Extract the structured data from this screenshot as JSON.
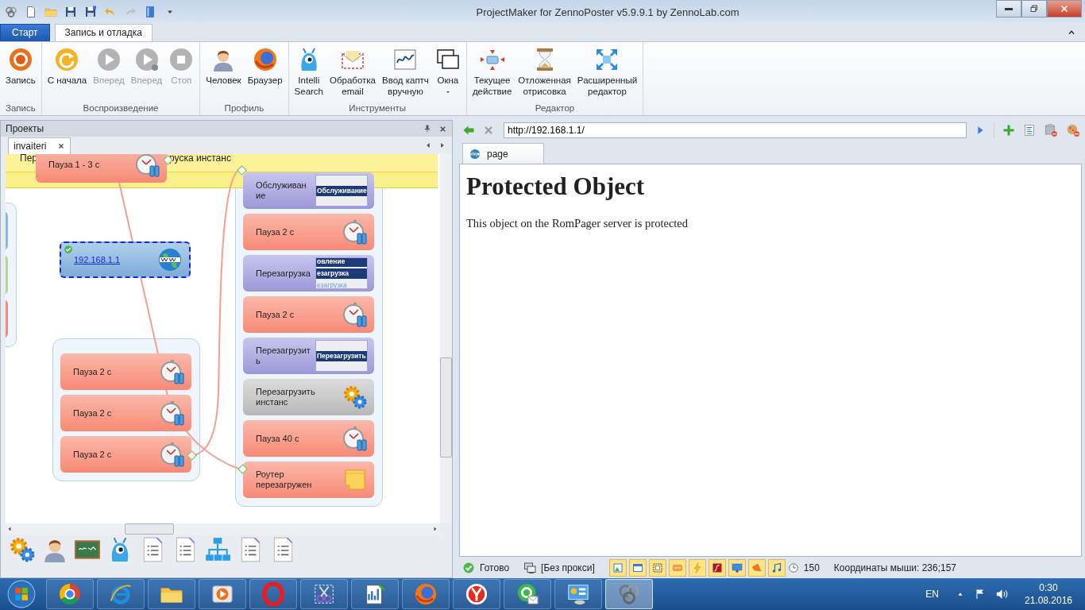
{
  "window": {
    "title": "ProjectMaker for ZennoPoster v5.9.9.1 by ZennoLab.com"
  },
  "ribbon": {
    "tabs": [
      {
        "label": "Старт",
        "kind": "menu",
        "selected": false
      },
      {
        "label": "Запись и отладка",
        "kind": "tab",
        "selected": true
      }
    ],
    "groups": [
      {
        "title": "Запись",
        "buttons": [
          {
            "label": "Запись",
            "disabled": false
          }
        ]
      },
      {
        "title": "Воспроизведение",
        "buttons": [
          {
            "label": "С начала",
            "disabled": false
          },
          {
            "label": "Вперед",
            "disabled": true
          },
          {
            "label": "Вперед",
            "disabled": true
          },
          {
            "label": "Стоп",
            "disabled": true
          }
        ]
      },
      {
        "title": "Профиль",
        "buttons": [
          {
            "label": "Человек",
            "disabled": false
          },
          {
            "label": "Браузер",
            "disabled": false
          }
        ]
      },
      {
        "title": "Инструменты",
        "buttons": [
          {
            "label": "Intelli\nSearch",
            "disabled": false
          },
          {
            "label": "Обработка\nemail",
            "disabled": false
          },
          {
            "label": "Ввод каптч\nвручную",
            "disabled": false
          },
          {
            "label": "Окна",
            "disabled": false,
            "dropdown": true
          }
        ]
      },
      {
        "title": "Редактор",
        "buttons": [
          {
            "label": "Текущее\nдействие",
            "disabled": false
          },
          {
            "label": "Отложенная\nотрисовка",
            "disabled": false
          },
          {
            "label": "Расширенный\nредактор",
            "disabled": false
          }
        ]
      }
    ]
  },
  "projects": {
    "title": "Проекты",
    "tabs": [
      {
        "label": "invaiteri",
        "selected": true
      }
    ],
    "canvas": {
      "band_texts": [
        "Пер",
        "руска инстанс"
      ],
      "offscreen_nodes": [
        {
          "color": "#8db8e3"
        },
        {
          "color": "#aedb94"
        },
        {
          "color": "#f48b7b"
        }
      ],
      "free_nodes": [
        {
          "kind": "pause",
          "label": "Пауза 1 - 3 с",
          "selected": false,
          "done": false
        },
        {
          "kind": "navigate",
          "label": "192.168.1.1",
          "selected": true,
          "done": true
        }
      ],
      "groups": [
        {
          "nodes": [
            {
              "kind": "pause",
              "label": "Пауза 2 с",
              "selected": false,
              "done": false
            },
            {
              "kind": "pause",
              "label": "Пауза 2 с",
              "selected": false,
              "done": false
            },
            {
              "kind": "pause",
              "label": "Пауза 2 с",
              "selected": false,
              "done": false
            }
          ]
        },
        {
          "nodes": [
            {
              "kind": "image",
              "label": "Обслуживан\nие",
              "snapshot": [
                "Обслуживание"
              ],
              "selected": false,
              "done": false
            },
            {
              "kind": "pause",
              "label": "Пауза 2 с",
              "selected": false,
              "done": false
            },
            {
              "kind": "image",
              "label": "Перезагрузка",
              "snapshot": [
                "овление",
                "езагрузка",
                "езагрузка"
              ],
              "selected": false,
              "done": false
            },
            {
              "kind": "pause",
              "label": "Пауза 2 с",
              "selected": false,
              "done": false
            },
            {
              "kind": "image",
              "label": "Перезагрузит\nь",
              "snapshot": [
                "Перезагрузить"
              ],
              "selected": false,
              "done": false
            },
            {
              "kind": "action",
              "label": "Перезагрузить\nинстанс",
              "selected": false,
              "done": false
            },
            {
              "kind": "pause",
              "label": "Пауза 40 с",
              "selected": false,
              "done": false
            },
            {
              "kind": "note",
              "label": "Роутер\nперезагружен",
              "selected": false,
              "done": false
            }
          ]
        }
      ]
    }
  },
  "browser": {
    "address": "http://192.168.1.1/",
    "tabs": [
      {
        "label": "page",
        "selected": true
      }
    ],
    "page": {
      "heading": "Protected Object",
      "text": "This object on the RomPager server is protected"
    }
  },
  "status_bar": {
    "status": "Готово",
    "proxy": "[Без прокси]",
    "threads": "150",
    "mouse": "Координаты мыши: 236;157"
  },
  "taskbar": {
    "apps": [
      {
        "active": false
      },
      {
        "active": false
      },
      {
        "active": false
      },
      {
        "active": false
      },
      {
        "active": false
      },
      {
        "active": false
      },
      {
        "active": false
      },
      {
        "active": false
      },
      {
        "active": false
      },
      {
        "active": false
      },
      {
        "active": false
      },
      {
        "active": true
      }
    ],
    "language": "EN",
    "time": "0:30",
    "date": "21.08.2016"
  }
}
